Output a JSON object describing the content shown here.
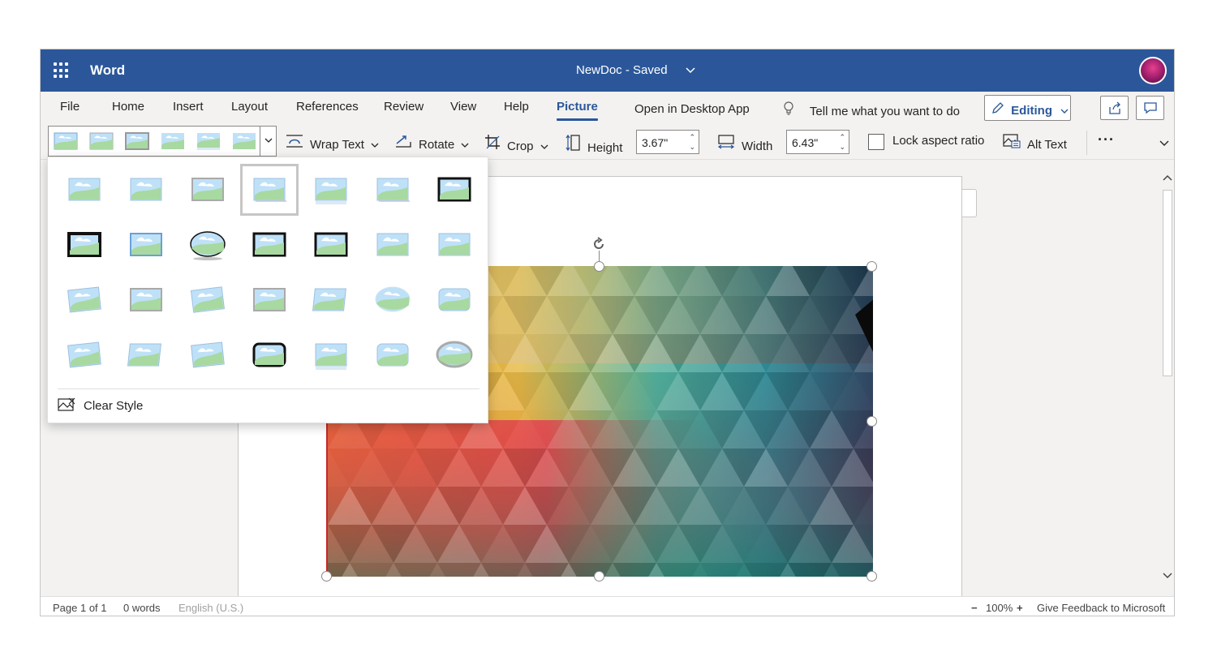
{
  "titlebar": {
    "app_name": "Word",
    "document_title": "NewDoc - Saved",
    "chevron": "⌄",
    "bg_color": "#2b579a"
  },
  "ribbon_tabs": [
    {
      "label": "File"
    },
    {
      "label": "Home"
    },
    {
      "label": "Insert"
    },
    {
      "label": "Layout"
    },
    {
      "label": "References"
    },
    {
      "label": "Review"
    },
    {
      "label": "View"
    },
    {
      "label": "Help"
    },
    {
      "label": "Picture",
      "active": true
    },
    {
      "label": "Open in Desktop App"
    }
  ],
  "tell_me": {
    "placeholder": "Tell me what you want to do",
    "icon": "lightbulb-icon"
  },
  "editing": {
    "label": "Editing",
    "icon": "pencil-icon"
  },
  "share_icon": "share-icon",
  "comments_icon": "comment-icon",
  "toolbar": {
    "wrap_text": "Wrap Text",
    "rotate": "Rotate",
    "crop": "Crop",
    "height_label": "Height",
    "height_value": "3.67\"",
    "width_label": "Width",
    "width_value": "6.43\"",
    "lock_aspect": "Lock aspect ratio",
    "alt_text": "Alt Text",
    "more": "···"
  },
  "picture_styles_dropdown": {
    "rows": 4,
    "columns": 7,
    "selected_index": 3,
    "clear_style": "Clear Style"
  },
  "statusbar": {
    "page": "Page 1 of 1",
    "words": "0 words",
    "language": "English (U.S.)",
    "zoom_minus": "−",
    "zoom": "100%",
    "zoom_plus": "+",
    "feedback": "Give Feedback to Microsoft"
  }
}
